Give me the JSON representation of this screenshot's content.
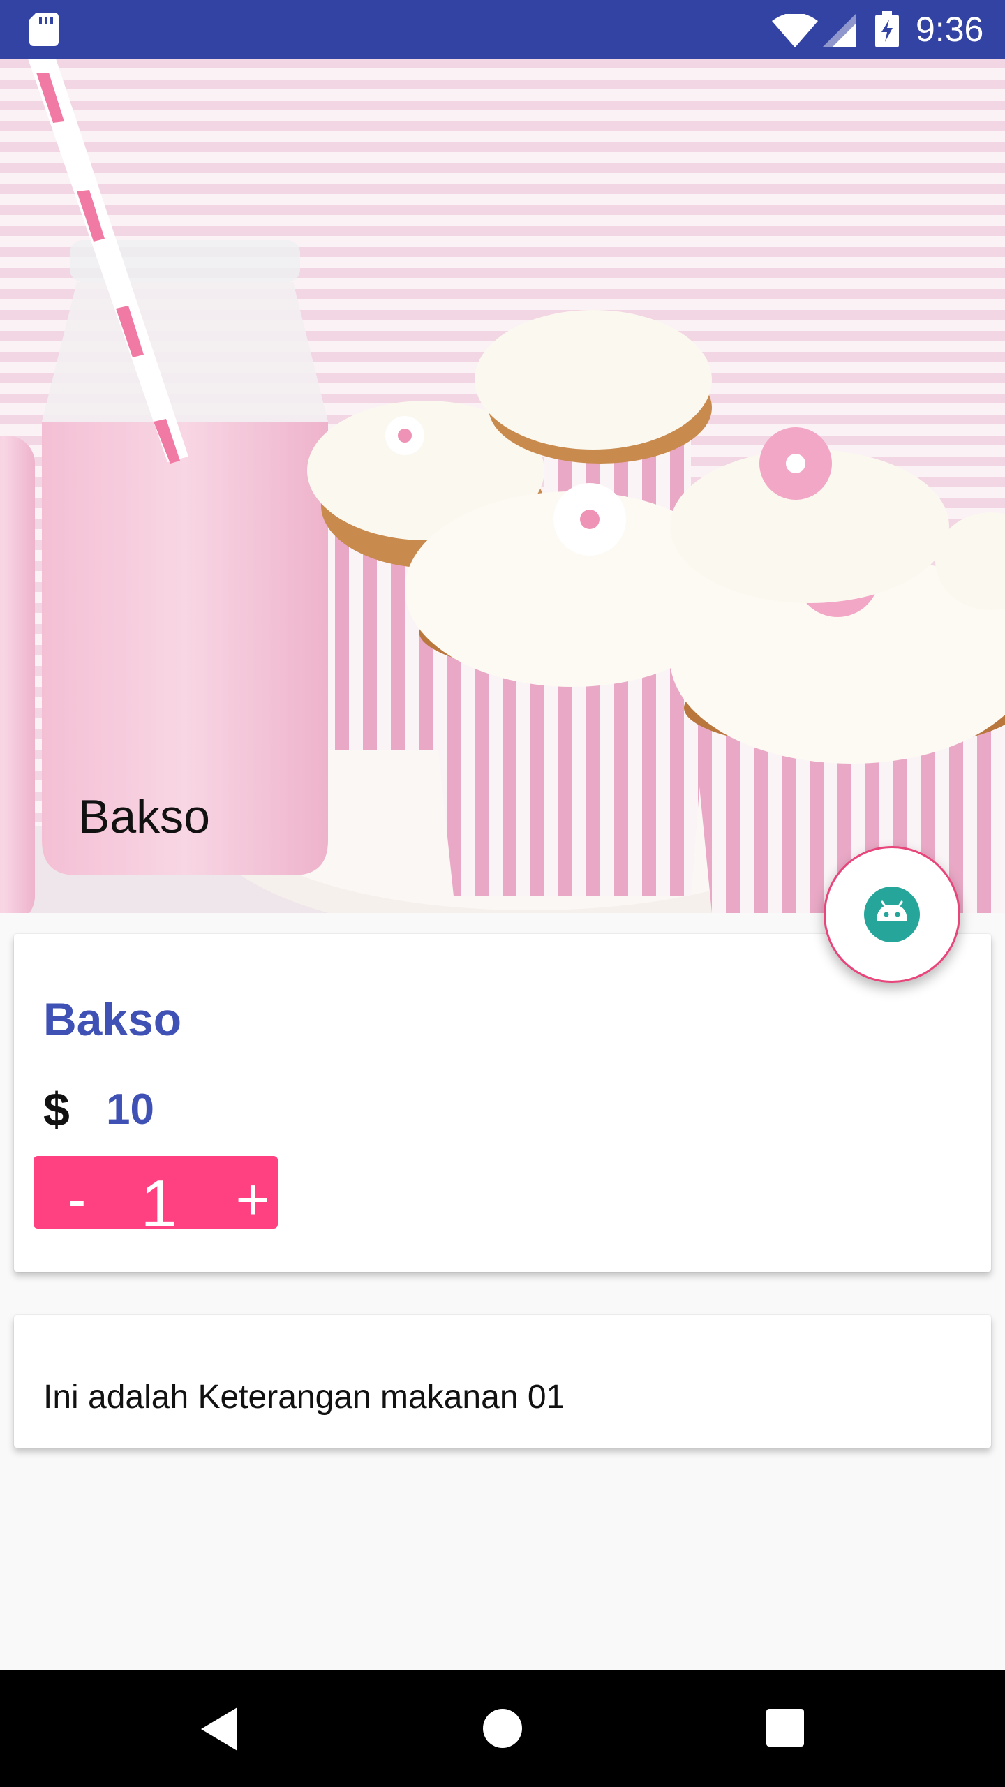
{
  "status_bar": {
    "time": "9:36",
    "icons": [
      "sd-card-icon",
      "wifi-icon",
      "signal-icon",
      "battery-charging-icon"
    ]
  },
  "hero": {
    "title": "Bakso",
    "image": "cupcakes-and-pink-milk-photo"
  },
  "fab": {
    "icon": "android-icon",
    "accent_color": "#e8457a"
  },
  "product": {
    "name": "Bakso",
    "currency_symbol": "$",
    "price": "10",
    "quantity": {
      "minus_label": "-",
      "value": "1",
      "plus_label": "+"
    }
  },
  "description": {
    "text": "Ini adalah Keterangan makanan 01"
  },
  "nav_bar": {
    "icons": [
      "back-icon",
      "home-icon",
      "recents-icon"
    ]
  },
  "colors": {
    "status_bar": "#3343a3",
    "primary": "#3f51b5",
    "accent": "#ff4081",
    "background": "#f9f9f9"
  }
}
